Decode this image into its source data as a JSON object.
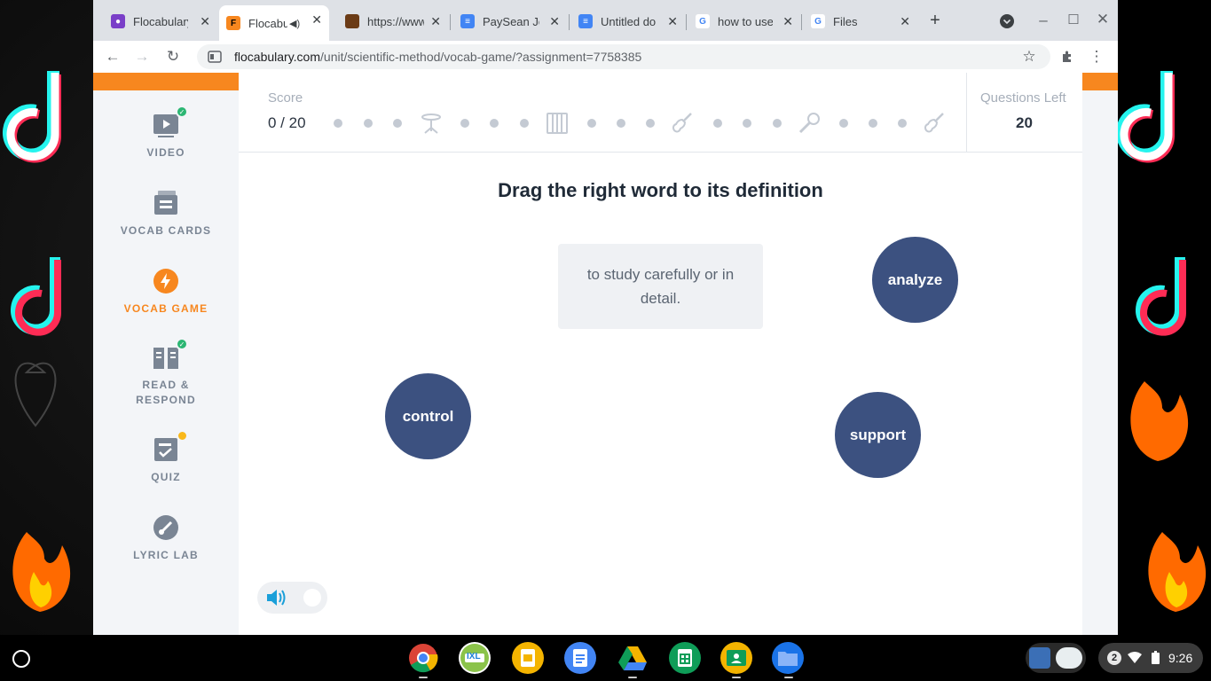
{
  "tabs": [
    {
      "label": "Flocabulary",
      "favicon": "person-icon",
      "color": "#7a3fc8",
      "active": false
    },
    {
      "label": "Flocabulary",
      "favicon": "flocabulary-icon",
      "color": "#f7871f",
      "active": true,
      "audio": true
    },
    {
      "label": "https://www.",
      "favicon": "portrait-icon",
      "color": "#6b3b16",
      "active": false
    },
    {
      "label": "PaySean Jo",
      "favicon": "docs-icon",
      "color": "#4285f4",
      "active": false
    },
    {
      "label": "Untitled do",
      "favicon": "docs-icon",
      "color": "#4285f4",
      "active": false
    },
    {
      "label": "how to use",
      "favicon": "google-icon",
      "color": "#ffffff",
      "active": false
    },
    {
      "label": "Files",
      "favicon": "google-icon",
      "color": "#ffffff",
      "active": false
    }
  ],
  "url": {
    "host": "flocabulary.com",
    "path": "/unit/scientific-method/vocab-game/?assignment=7758385"
  },
  "sidebar": {
    "items": [
      {
        "label": "VIDEO",
        "icon": "video-icon",
        "status": "complete"
      },
      {
        "label": "VOCAB CARDS",
        "icon": "vocab-cards-icon",
        "status": "none"
      },
      {
        "label": "VOCAB GAME",
        "icon": "lightning-icon",
        "status": "active"
      },
      {
        "label": "READ &",
        "label2": "RESPOND",
        "icon": "book-icon",
        "status": "complete"
      },
      {
        "label": "QUIZ",
        "icon": "quiz-icon",
        "status": "pending"
      },
      {
        "label": "LYRIC LAB",
        "icon": "lyric-lab-icon",
        "status": "none"
      }
    ]
  },
  "game": {
    "score_label": "Score",
    "score_value": "0 / 20",
    "questions_left_label": "Questions Left",
    "questions_left_value": "20",
    "instruction": "Drag the right word to its definition",
    "definition": "to study carefully or in detail.",
    "words": [
      "analyze",
      "control",
      "support"
    ],
    "progress_icons": [
      "drum-icon",
      "piano-icon",
      "guitar-icon",
      "microphone-icon",
      "guitar-icon"
    ]
  },
  "shelf": {
    "apps": [
      "chrome-icon",
      "ixl-icon",
      "slides-icon",
      "docs-icon",
      "drive-icon",
      "sheets-icon",
      "classroom-icon",
      "files-icon"
    ],
    "app_badge": "IXL",
    "notifications": "2",
    "time": "9:26"
  }
}
